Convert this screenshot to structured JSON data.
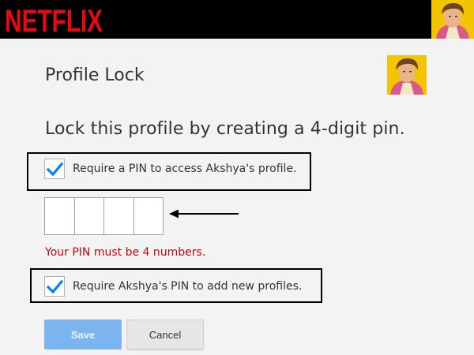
{
  "header": {
    "brand": "NETFLIX",
    "brand_color": "#e50914",
    "avatar_icon": "profile-avatar-icon"
  },
  "page": {
    "title": "Profile Lock",
    "headline": "Lock this profile by creating a 4-digit pin."
  },
  "options": {
    "require_pin_label": "Require a PIN to access Akshya's profile.",
    "require_pin_checked": true,
    "add_profiles_label": "Require Akshya's PIN to add new profiles.",
    "add_profiles_checked": true
  },
  "pin": {
    "digits": [
      "",
      "",
      "",
      ""
    ],
    "error": "Your PIN must be 4 numbers."
  },
  "buttons": {
    "save_label": "Save",
    "cancel_label": "Cancel"
  },
  "colors": {
    "accent": "#0080ff",
    "error": "#b9090b",
    "save_disabled": "#7ab5f0"
  }
}
